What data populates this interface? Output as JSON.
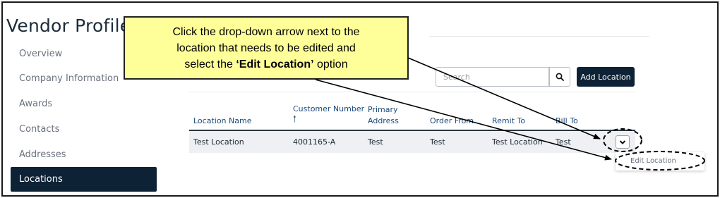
{
  "sidebar": {
    "title": "Vendor Profile",
    "items": [
      {
        "label": "Overview"
      },
      {
        "label": "Company Information"
      },
      {
        "label": "Awards"
      },
      {
        "label": "Contacts"
      },
      {
        "label": "Addresses"
      },
      {
        "label": "Locations",
        "active": true
      }
    ]
  },
  "toolbar": {
    "search_placeholder": "Search",
    "add_location_label": "Add Location",
    "search_icon": "search-icon"
  },
  "table": {
    "headers": {
      "location_name": "Location Name",
      "customer_number": "Customer Number",
      "sort_arrow": "🠑",
      "primary_line1": "Primary",
      "primary_line2": "Address",
      "order_from": "Order From",
      "remit_to": "Remit To",
      "bill_to": "Bill To"
    },
    "rows": [
      {
        "location_name": "Test Location",
        "customer_number": "4001165-A",
        "primary_address": "Test",
        "order_from": "Test",
        "remit_to": "Test Location",
        "bill_to": "Test"
      }
    ]
  },
  "row_menu": {
    "edit_location": "Edit Location",
    "toggle_icon": "chevron-down-icon"
  },
  "callout": {
    "line1": "Click the drop-down arrow next to the",
    "line2": "location that needs to be edited and",
    "line3_prefix": "select the ",
    "line3_bold": "‘Edit Location’",
    "line3_suffix": " option"
  },
  "colors": {
    "navy": "#0e2236",
    "callout_bg": "#ffff99",
    "header_text": "#1c4a7a"
  }
}
